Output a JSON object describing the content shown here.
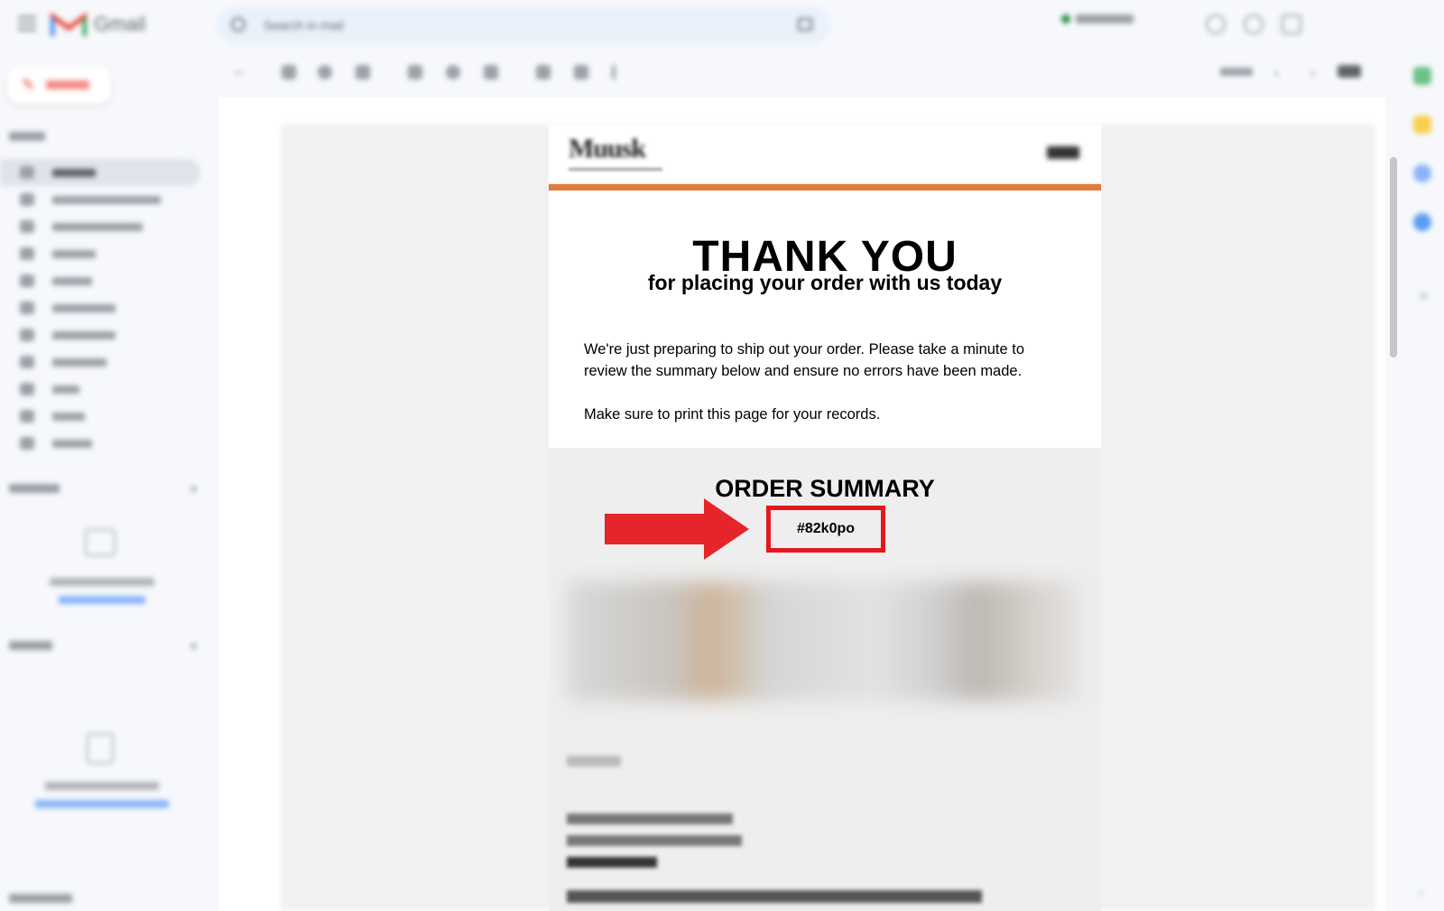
{
  "gmail": {
    "app_name": "Gmail",
    "search_placeholder": "Search in mail"
  },
  "email": {
    "headline": "THANK YOU",
    "subheadline": "for placing your order with us today",
    "paragraph_1": "We're just preparing to ship out your order. Please take a minute to review the summary below and ensure no errors have been made.",
    "paragraph_2": "Make sure to print this page for your records.",
    "summary_title": "ORDER SUMMARY",
    "order_number": "#82k0po"
  },
  "colors": {
    "accent_orange": "#e07b3c",
    "highlight_red": "#e3171f",
    "arrow_red": "#e5252b"
  }
}
